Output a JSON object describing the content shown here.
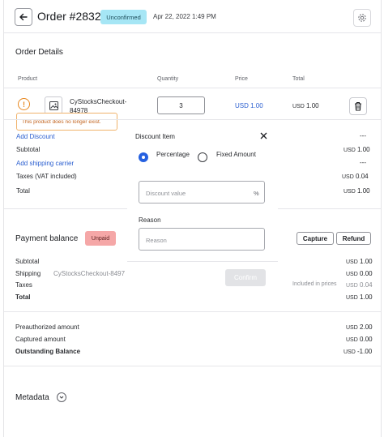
{
  "header": {
    "title": "Order #2832",
    "status_badge": "Unconfirmed",
    "date": "Apr 22, 2022 1:49 PM"
  },
  "order_details": {
    "title": "Order Details",
    "columns": {
      "product": "Product",
      "quantity": "Quantity",
      "price": "Price",
      "total": "Total"
    },
    "line": {
      "product_name": "CyStocksCheckout-84978",
      "quantity": "3",
      "price": "USD 1.00",
      "total_currency": "USD",
      "total_amount": "1.00",
      "warning": "This product does no longer exist."
    },
    "summary": {
      "add_discount": "Add Discount",
      "discount_value": "---",
      "subtotal_label": "Subtotal",
      "subtotal_currency": "USD",
      "subtotal_amount": "1.00",
      "shipping_link": "Add shipping carrier",
      "shipping_value": "---",
      "taxes_label": "Taxes (VAT included)",
      "taxes_currency": "USD",
      "taxes_amount": "0.04",
      "total_label": "Total",
      "total_currency": "USD",
      "total_amount": "1.00"
    }
  },
  "discount_popover": {
    "title": "Discount Item",
    "option_percentage": "Percentage",
    "option_fixed": "Fixed Amount",
    "selected": "Percentage",
    "value_placeholder": "Discount value",
    "value_suffix": "%",
    "reason_label": "Reason",
    "reason_placeholder": "Reason",
    "confirm_label": "Confirm"
  },
  "payment": {
    "title": "Payment balance",
    "status_badge": "Unpaid",
    "capture_label": "Capture",
    "refund_label": "Refund",
    "subtotal_label": "Subtotal",
    "subtotal_currency": "USD",
    "subtotal_amount": "1.00",
    "shipping_label": "Shipping",
    "shipping_method": "CyStocksCheckout-8497",
    "shipping_currency": "USD",
    "shipping_amount": "0.00",
    "taxes_label": "Taxes",
    "taxes_note": "Included in prices",
    "taxes_currency": "USD",
    "taxes_amount": "0.04",
    "total_label": "Total",
    "total_currency": "USD",
    "total_amount": "1.00",
    "preauthorized_label": "Preauthorized amount",
    "preauthorized_currency": "USD",
    "preauthorized_amount": "2.00",
    "captured_label": "Captured amount",
    "captured_currency": "USD",
    "captured_amount": "0.00",
    "outstanding_label": "Outstanding Balance",
    "outstanding_currency": "USD",
    "outstanding_amount": "-1.00"
  },
  "metadata": {
    "title": "Metadata"
  },
  "icons": {
    "back": "arrow-left-icon",
    "settings": "gear-icon",
    "warning": "warning-circle-icon",
    "image": "image-placeholder-icon",
    "delete": "trash-icon",
    "close": "close-icon",
    "expand": "chevron-down-icon"
  },
  "colors": {
    "accent": "#2560e0",
    "unconfirmed_badge": "#a6e6f5",
    "unpaid_badge": "#f5a7a7",
    "warning": "#e8871e"
  }
}
